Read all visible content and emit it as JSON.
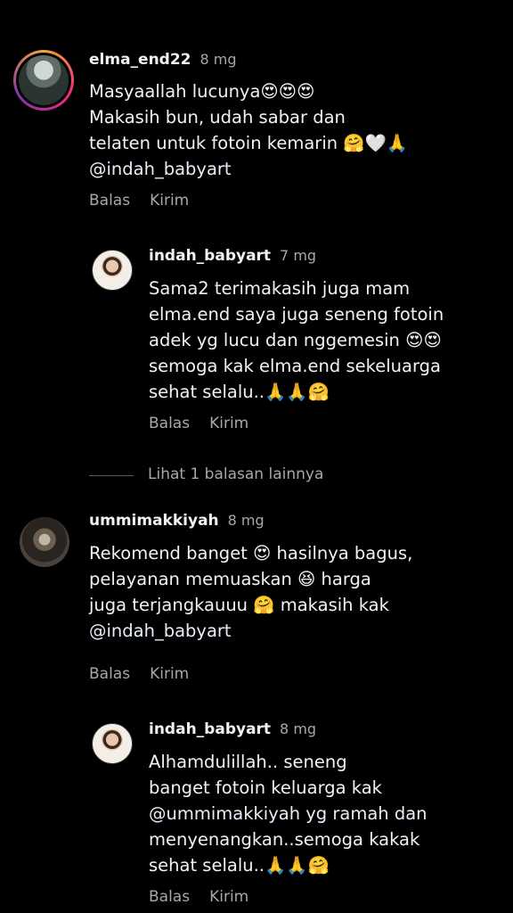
{
  "comments": [
    {
      "username": "elma_end22",
      "time": "8 mg",
      "lines": [
        "Masyaallah lucunya😍😍😍",
        "Makasih bun, udah sabar dan",
        "telaten untuk fotoin kemarin 🤗🤍🙏",
        "@indah_babyart"
      ],
      "reply_label": "Balas",
      "send_label": "Kirim"
    },
    {
      "username": "indah_babyart",
      "time": "7 mg",
      "lines": [
        "Sama2 terimakasih juga mam",
        "elma.end saya juga seneng fotoin",
        "adek yg lucu dan nggemesin 😍😍",
        "semoga kak elma.end sekeluarga",
        "sehat selalu..🙏🙏🤗"
      ],
      "reply_label": "Balas",
      "send_label": "Kirim"
    },
    {
      "username": "ummimakkiyah",
      "time": "8 mg",
      "lines": [
        "Rekomend banget 😍 hasilnya bagus,",
        "pelayanan memuaskan 😆 harga",
        "juga terjangkauuu 🤗 makasih kak",
        "@indah_babyart"
      ],
      "reply_label": "Balas",
      "send_label": "Kirim"
    },
    {
      "username": "indah_babyart",
      "time": "8 mg",
      "lines": [
        "Alhamdulillah.. seneng",
        "banget fotoin keluarga kak",
        "@ummimakkiyah yg ramah dan",
        "menyenangkan..semoga kakak",
        "sehat selalu..🙏🙏🤗"
      ],
      "reply_label": "Balas",
      "send_label": "Kirim"
    }
  ],
  "view_more_replies": "Lihat 1 balasan lainnya"
}
